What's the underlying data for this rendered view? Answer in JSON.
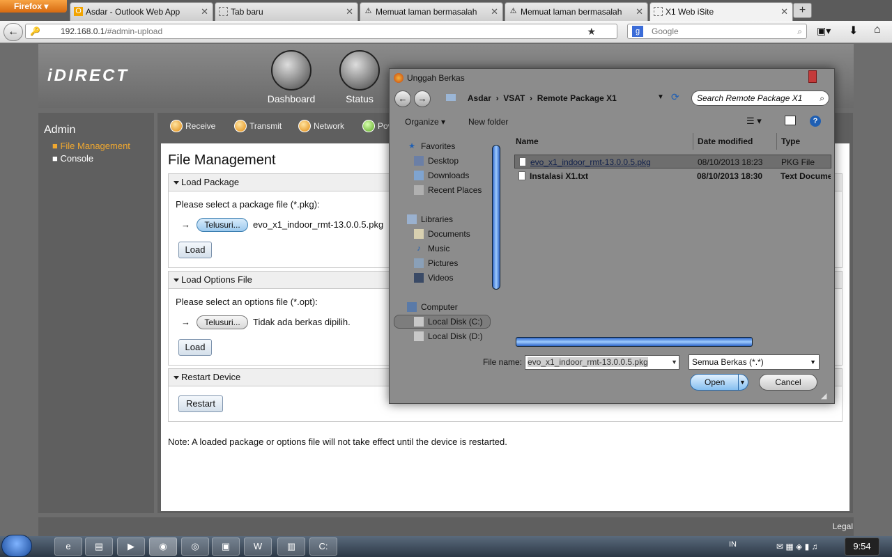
{
  "browser": {
    "menu_label": "Firefox",
    "tabs": [
      {
        "label": "Asdar - Outlook Web App",
        "icon": "outlook-icon"
      },
      {
        "label": "Tab baru",
        "icon": "page-icon"
      },
      {
        "label": "Memuat laman bermasalah",
        "icon": "warning-icon"
      },
      {
        "label": "Memuat laman bermasalah",
        "icon": "warning-icon"
      },
      {
        "label": "X1 Web iSite",
        "icon": "page-icon"
      }
    ],
    "new_tab": "+",
    "url_host": "192.168.0.1",
    "url_path": "/#admin-upload",
    "search_placeholder": "Google"
  },
  "site": {
    "logo": "iDIRECT",
    "nav": [
      {
        "label": "Dashboard"
      },
      {
        "label": "Status"
      }
    ],
    "sidebar": {
      "title": "Admin",
      "items": [
        {
          "label": "File Management",
          "active": true
        },
        {
          "label": "Console",
          "active": false
        }
      ]
    },
    "subtabs": [
      "Receive",
      "Transmit",
      "Network",
      "Pov"
    ],
    "page_title": "File Management",
    "load_package": {
      "header": "Load Package",
      "prompt": "Please select a package file (*.pkg):",
      "arrow": "→",
      "browse": "Telusuri...",
      "file": "evo_x1_indoor_rmt-13.0.0.5.pkg",
      "button": "Load"
    },
    "load_options": {
      "header": "Load Options File",
      "prompt": "Please select an options file (*.opt):",
      "arrow": "→",
      "browse": "Telusuri...",
      "file": "Tidak ada berkas dipilih.",
      "button": "Load"
    },
    "restart": {
      "header": "Restart Device",
      "button": "Restart"
    },
    "note": "Note: A loaded package or options file will not take effect until the device is restarted.",
    "footer_link": "Legal"
  },
  "dialog": {
    "title": "Unggah Berkas",
    "breadcrumb": [
      "Asdar",
      "VSAT",
      "Remote Package X1"
    ],
    "search_placeholder": "Search Remote Package X1",
    "organize": "Organize",
    "new_folder": "New folder",
    "tree": {
      "favorites": {
        "label": "Favorites",
        "items": [
          "Desktop",
          "Downloads",
          "Recent Places"
        ]
      },
      "libraries": {
        "label": "Libraries",
        "items": [
          "Documents",
          "Music",
          "Pictures",
          "Videos"
        ]
      },
      "computer": {
        "label": "Computer",
        "items": [
          "Local Disk (C:)",
          "Local Disk (D:)"
        ]
      }
    },
    "columns": [
      "Name",
      "Date modified",
      "Type"
    ],
    "files": [
      {
        "name": "evo_x1_indoor_rmt-13.0.0.5.pkg",
        "date": "08/10/2013 18:23",
        "type": "PKG File",
        "selected": true
      },
      {
        "name": "Instalasi X1.txt",
        "date": "08/10/2013 18:30",
        "type": "Text Docume",
        "selected": false
      }
    ],
    "file_name_label": "File name:",
    "file_name_value": "evo_x1_indoor_rmt-13.0.0.5.pkg",
    "file_type": "Semua Berkas (*.*)",
    "open": "Open",
    "cancel": "Cancel"
  },
  "taskbar": {
    "language": "IN",
    "time": "9:54"
  }
}
